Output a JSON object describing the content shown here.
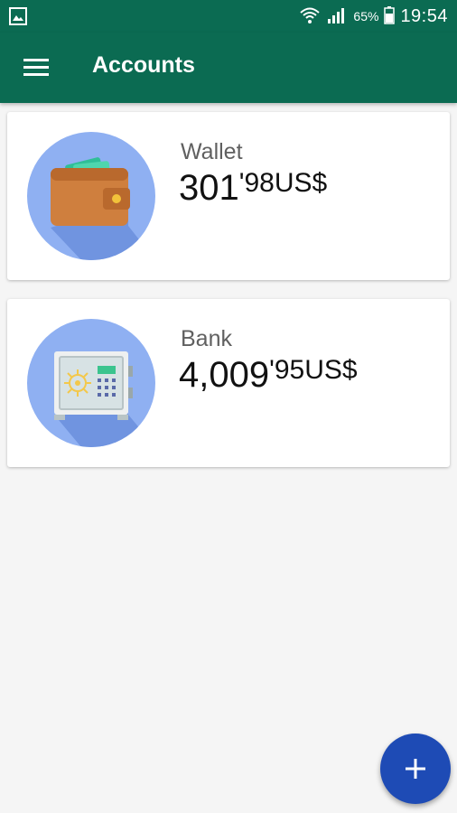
{
  "status_bar": {
    "battery": "65%",
    "time": "19:54",
    "icons": [
      "gallery-notification-icon",
      "wifi-icon",
      "signal-icon",
      "battery-icon"
    ]
  },
  "app_bar": {
    "title": "Accounts",
    "menu_icon": "menu-icon"
  },
  "accounts": [
    {
      "name": "Wallet",
      "amount_int": "301",
      "amount_dec": "'98",
      "currency": "US$",
      "icon": "wallet-icon"
    },
    {
      "name": "Bank",
      "amount_int": "4,009",
      "amount_dec": "'95",
      "currency": "US$",
      "icon": "safe-icon"
    }
  ],
  "fab": {
    "label": "+",
    "icon": "add-icon"
  },
  "colors": {
    "primary": "#0b6b52",
    "fab": "#1e4bb5",
    "avatar_bg": "#8fb0f2",
    "background": "#f5f5f5"
  }
}
